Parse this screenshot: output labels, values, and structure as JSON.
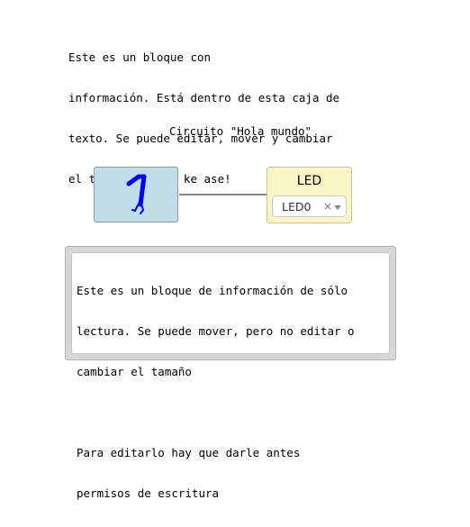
{
  "info_block": {
    "lines": [
      "Este es un bloque con",
      "información. Está dentro de esta caja de",
      "texto. Se puede editar, mover y cambiar",
      "el tamaño....ola ke ase!"
    ]
  },
  "circuit": {
    "title": "Circuito \"Hola mundo\"",
    "input_block": {
      "icon": "digital-one-icon",
      "color": "#c0dde9",
      "icon_color": "#0000ff"
    },
    "led_block": {
      "title": "LED",
      "selected": "LED0",
      "clear_symbol": "×",
      "color": "#fbf6c7"
    }
  },
  "readonly_block": {
    "lines": [
      "Este es un bloque de información de sólo",
      "lectura. Se puede mover, pero no editar o",
      "cambiar el tamaño",
      "",
      "Para editarlo hay que darle antes",
      "permisos de escritura"
    ]
  }
}
